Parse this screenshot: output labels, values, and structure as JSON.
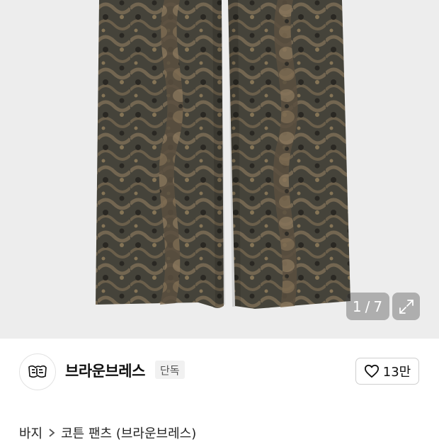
{
  "gallery": {
    "current": "1",
    "separator": "/",
    "total": "7",
    "image_alt": "snake-print pants",
    "expand_icon": "expand-icon"
  },
  "brand": {
    "name": "브라운브레스",
    "badge": "단독",
    "logo_icon": "brand-logo-icon",
    "likes": "13만",
    "like_icon": "heart-outline-icon"
  },
  "breadcrumb": {
    "category": "바지",
    "separator_icon": "chevron-right-icon",
    "subcategory": "코튼 팬츠",
    "brand_suffix": "(브라운브레스)"
  },
  "colors": {
    "hero_bg": "#ededed",
    "pattern_dark": "#2f2d27",
    "pattern_light": "#7a6a54"
  }
}
